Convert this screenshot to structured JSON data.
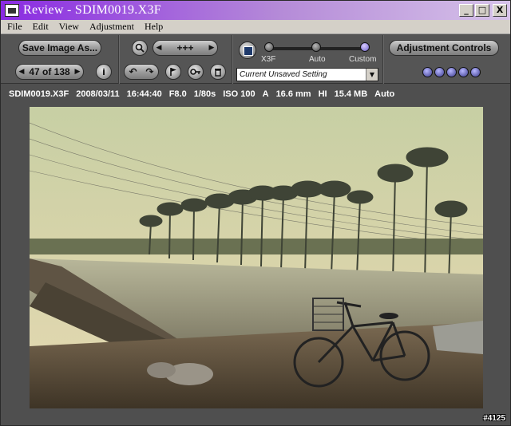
{
  "window": {
    "title": "Review - SDIM0019.X3F",
    "buttons": {
      "minimize": "_",
      "maximize": "□",
      "close": "X"
    }
  },
  "menu": [
    "File",
    "Edit",
    "View",
    "Adjustment",
    "Help"
  ],
  "toolbar": {
    "save_label": "Save Image As...",
    "zoom_value": "+++",
    "nav_counter": "47 of 138",
    "info_glyph": "i",
    "slider_labels": [
      "X3F",
      "Auto",
      "Custom"
    ],
    "selected_stop": "Custom",
    "setting_value": "Current Unsaved Setting",
    "adjust_label": "Adjustment Controls"
  },
  "icons": {
    "zoom": "magnifier-icon",
    "rotate_left": "rotate-left-icon",
    "rotate_right": "rotate-right-icon",
    "flag": "flag-icon",
    "key": "key-icon",
    "trash": "trash-icon",
    "preset": "preset-icon"
  },
  "info": {
    "filename": "SDIM0019.X3F",
    "date": "2008/03/11",
    "time": "16:44:40",
    "aperture": "F8.0",
    "shutter": "1/80s",
    "iso": "ISO 100",
    "mode": "A",
    "focal": "16.6 mm",
    "quality": "HI",
    "size": "15.4 MB",
    "wb": "Auto"
  },
  "watermark": "#4125",
  "colors": {
    "title_gradient_start": "#8a2be2",
    "panel_bg": "#4f4f4f",
    "accent_dots": "#3a3a8a"
  }
}
